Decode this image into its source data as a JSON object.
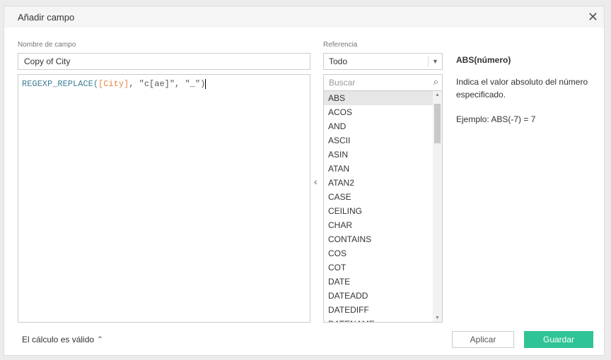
{
  "dialog": {
    "title": "Añadir campo"
  },
  "field": {
    "label": "Nombre de campo",
    "value": "Copy of City"
  },
  "formula": {
    "fn": "REGEXP_REPLACE(",
    "field": "[City]",
    "rest": ", \"c[ae]\", \"_\")"
  },
  "reference": {
    "label": "Referencia",
    "selected": "Todo",
    "search_placeholder": "Buscar",
    "functions": [
      "ABS",
      "ACOS",
      "AND",
      "ASCII",
      "ASIN",
      "ATAN",
      "ATAN2",
      "CASE",
      "CEILING",
      "CHAR",
      "CONTAINS",
      "COS",
      "COT",
      "DATE",
      "DATEADD",
      "DATEDIFF",
      "DATENAME"
    ]
  },
  "help": {
    "title": "ABS(número)",
    "description": "Indica el valor absoluto del número especificado.",
    "example": "Ejemplo: ABS(-7) = 7"
  },
  "footer": {
    "status": "El cálculo es válido",
    "apply": "Aplicar",
    "save": "Guardar"
  },
  "colors": {
    "accent": "#2fc495"
  }
}
